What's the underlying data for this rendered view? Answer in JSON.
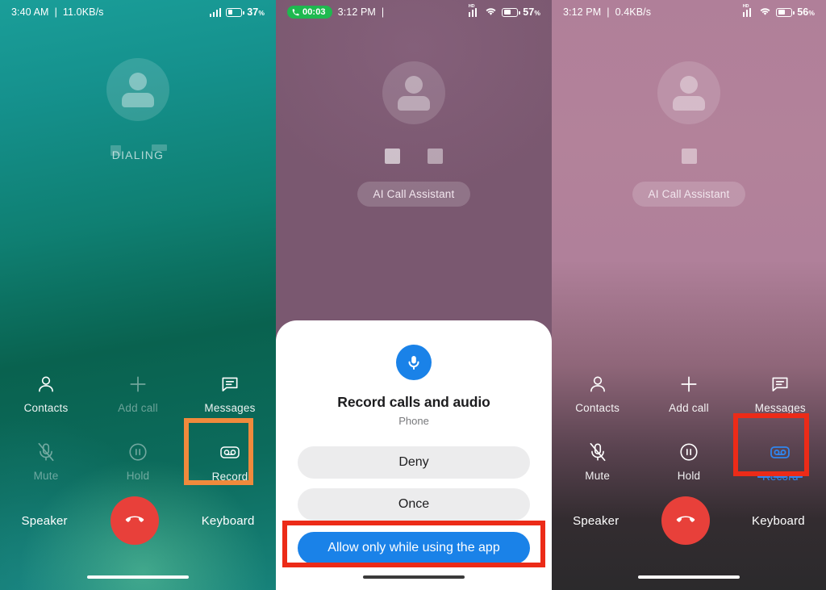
{
  "colors": {
    "teal_bg": "#1a9e99",
    "mauve_bg": "#7b5870",
    "pink_bg": "#b07f99",
    "accent_blue": "#1a82e8",
    "active_blue": "#2f86f0",
    "end_call_red": "#e8403a",
    "highlight_orange": "#f08a3c",
    "highlight_red": "#ec2b18",
    "status_green": "#1eb94f"
  },
  "panels": [
    {
      "id": "panel-dialing",
      "status_bar": {
        "time": "3:40 AM",
        "separator": "|",
        "network_speed": "11.0KB/s",
        "battery_percent": "37",
        "percent_symbol": "%",
        "has_call_timer": false,
        "has_wifi": false,
        "signal_icon": "signal-bars-icon",
        "battery_icon": "battery-icon"
      },
      "caller": {
        "avatar_icon": "person-avatar-icon",
        "state_text": "DIALING"
      },
      "controls": [
        {
          "label": "Contacts",
          "icon": "contacts-person-icon",
          "state": "enabled"
        },
        {
          "label": "Add call",
          "icon": "plus-icon",
          "state": "disabled"
        },
        {
          "label": "Messages",
          "icon": "message-bubble-icon",
          "state": "enabled"
        },
        {
          "label": "Mute",
          "icon": "mic-muted-icon",
          "state": "disabled"
        },
        {
          "label": "Hold",
          "icon": "pause-circle-icon",
          "state": "disabled"
        },
        {
          "label": "Record",
          "icon": "record-tape-icon",
          "state": "enabled"
        }
      ],
      "bottom": {
        "left_label": "Speaker",
        "right_label": "Keyboard",
        "end_call_icon": "end-call-handset-icon"
      },
      "highlight": {
        "target": "Record",
        "color": "#f08a3c"
      }
    },
    {
      "id": "panel-permission",
      "status_bar": {
        "time": "3:12 PM",
        "separator": "|",
        "network_speed": "",
        "battery_percent": "57",
        "percent_symbol": "%",
        "has_call_timer": true,
        "call_timer": "00:03",
        "call_timer_icon": "phone-handset-icon",
        "has_wifi": true,
        "signal_icon": "signal-bars-icon",
        "wifi_icon": "wifi-icon",
        "battery_icon": "battery-icon"
      },
      "caller": {
        "avatar_icon": "person-avatar-icon",
        "glyph_boxes": 2,
        "ai_pill_label": "AI Call Assistant"
      },
      "dialog": {
        "icon": "microphone-icon",
        "title": "Record calls and audio",
        "subtitle": "Phone",
        "buttons": [
          {
            "label": "Deny",
            "style": "secondary"
          },
          {
            "label": "Once",
            "style": "secondary"
          },
          {
            "label": "Allow only while using the app",
            "style": "primary"
          }
        ],
        "highlight": {
          "target": "Allow only while using the app",
          "color": "#ec2b18"
        }
      }
    },
    {
      "id": "panel-recording",
      "status_bar": {
        "time": "3:12 PM",
        "separator": "|",
        "network_speed": "0.4KB/s",
        "battery_percent": "56",
        "percent_symbol": "%",
        "has_call_timer": false,
        "has_wifi": true,
        "signal_icon": "signal-bars-icon",
        "wifi_icon": "wifi-icon",
        "battery_icon": "battery-icon"
      },
      "caller": {
        "avatar_icon": "person-avatar-icon",
        "glyph_boxes": 1,
        "ai_pill_label": "AI Call Assistant"
      },
      "controls": [
        {
          "label": "Contacts",
          "icon": "contacts-person-icon",
          "state": "enabled"
        },
        {
          "label": "Add call",
          "icon": "plus-icon",
          "state": "enabled"
        },
        {
          "label": "Messages",
          "icon": "message-bubble-icon",
          "state": "enabled"
        },
        {
          "label": "Mute",
          "icon": "mic-muted-icon",
          "state": "enabled"
        },
        {
          "label": "Hold",
          "icon": "pause-circle-icon",
          "state": "enabled"
        },
        {
          "label": "Record",
          "icon": "record-tape-icon",
          "state": "active"
        }
      ],
      "bottom": {
        "left_label": "Speaker",
        "right_label": "Keyboard",
        "end_call_icon": "end-call-handset-icon"
      },
      "highlight": {
        "target": "Record",
        "color": "#ec2b18"
      }
    }
  ]
}
